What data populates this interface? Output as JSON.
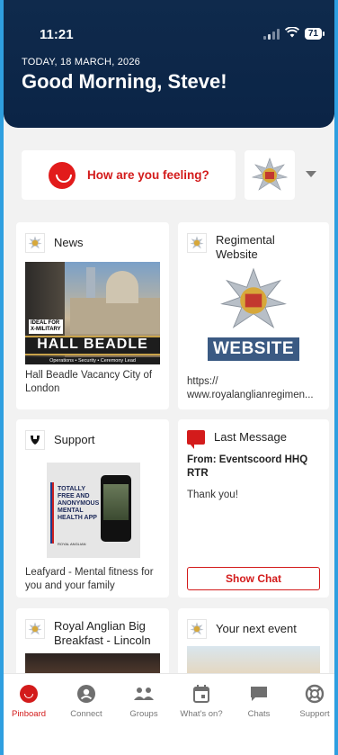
{
  "status": {
    "time": "11:21",
    "battery": "71"
  },
  "header": {
    "date": "TODAY, 18 MARCH, 2026",
    "greeting": "Good Morning, Steve!"
  },
  "mood": {
    "prompt": "How are you feeling?"
  },
  "cards": {
    "news": {
      "title": "News",
      "image_badge": "IDEAL FOR\nX-MILITARY",
      "image_title": "HALL BEADLE",
      "image_sub": "Operations • Security • Ceremony Lead",
      "caption": "Hall Beadle Vacancy City of London"
    },
    "website": {
      "title": "Regimental Website",
      "image_label": "WEBSITE",
      "url": "https://\nwww.royalanglianregimen..."
    },
    "support": {
      "title": "Support",
      "image_text": "TOTALLY FREE AND ANONYMOUS MENTAL HEALTH APP",
      "image_brand": "ROYAL ANGLIAN",
      "caption": "Leafyard - Mental fitness for you and your family"
    },
    "last_message": {
      "title": "Last Message",
      "from": "From: Eventscoord HHQ RTR",
      "message": "Thank you!",
      "button": "Show Chat"
    },
    "breakfast": {
      "title": "Royal Anglian Big Breakfast - Lincoln"
    },
    "event": {
      "title": "Your next event"
    }
  },
  "tabs": [
    {
      "label": "Pinboard",
      "icon": "pinboard-icon",
      "active": true
    },
    {
      "label": "Connect",
      "icon": "person-icon",
      "active": false
    },
    {
      "label": "Groups",
      "icon": "groups-icon",
      "active": false
    },
    {
      "label": "What's on?",
      "icon": "calendar-icon",
      "active": false
    },
    {
      "label": "Chats",
      "icon": "chat-icon",
      "active": false
    },
    {
      "label": "Support",
      "icon": "lifebuoy-icon",
      "active": false
    }
  ],
  "colors": {
    "accent": "#d31b1b",
    "header": "#0b2446",
    "background": "#f2f2f2"
  }
}
